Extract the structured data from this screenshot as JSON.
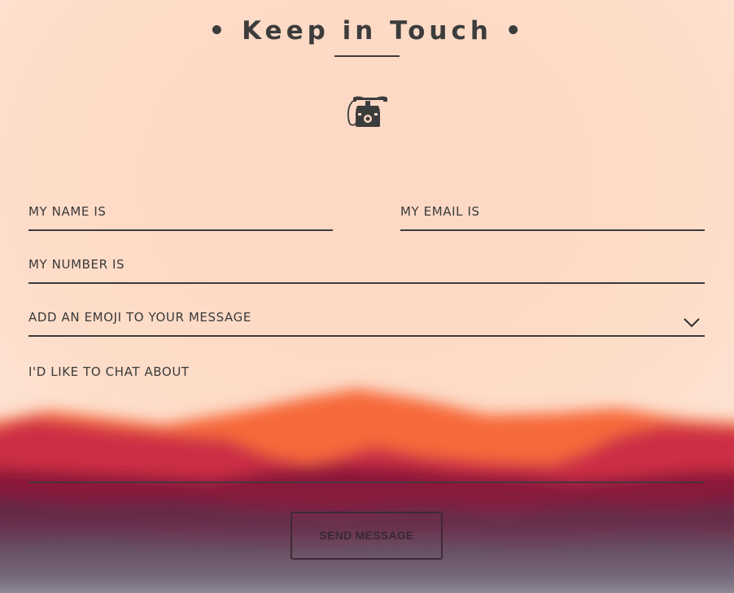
{
  "page": {
    "title": "• Keep in Touch •"
  },
  "form": {
    "name_label": "MY NAME IS",
    "email_label": "MY EMAIL IS",
    "number_label": "MY NUMBER IS",
    "emoji_label": "ADD AN EMOJI TO YOUR MESSAGE",
    "chat_label": "I'D LIKE TO CHAT ABOUT",
    "send_label": "SEND MESSAGE"
  },
  "icons": {
    "header_icon": "telephone-icon",
    "dropdown_icon": "chevron-down-icon"
  },
  "colors": {
    "text": "#3c3c3c",
    "background_top": "#fde0cc",
    "mountain_orange": "#f7693a",
    "mountain_red": "#c92e45",
    "mountain_plum": "#5a1c3c"
  }
}
